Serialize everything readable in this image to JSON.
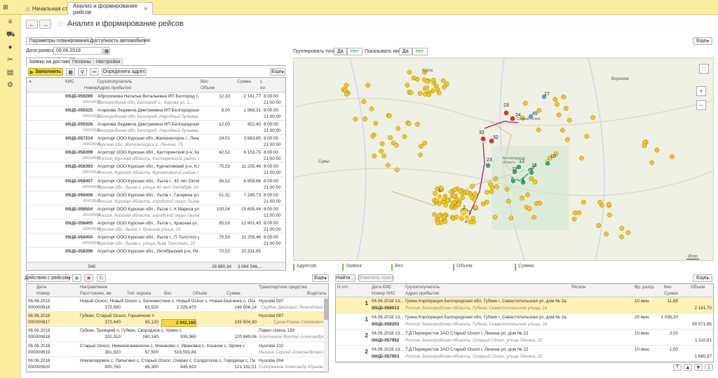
{
  "tabs": {
    "home": "Начальная страница",
    "active": "Анализ и формирование рейсов"
  },
  "page": {
    "title": "Анализ и формирование рейсов"
  },
  "toolbar": {
    "params": "Параметры планирования",
    "availability": "Доступность автомобилей",
    "more": "Еще"
  },
  "date": {
    "label": "Дата развоза:",
    "value": "06.06.2018"
  },
  "map_controls": {
    "group_label": "Группировать точки",
    "show_names_label": "Показывать имя",
    "yes": "Да",
    "no": "Нет",
    "scale": "20 km"
  },
  "subtabs": [
    "Заявки на доставку",
    "Геозоны",
    "Настройки"
  ],
  "orders_toolbar": {
    "fill": "Заполнить",
    "define_address": "Определить адрес",
    "more": "Еще"
  },
  "orders": {
    "headers": {
      "kis": "КИС",
      "number": "Номер",
      "consignee": "Грузополучатель",
      "address": "Адрес прибытия",
      "weight": "Вес",
      "volume": "Объем",
      "sum": "Сумма",
      "from": "с",
      "to": "по"
    },
    "rows": [
      {
        "kis": "00ЦБ-059289",
        "num": "000018373",
        "name": "Абросимова Наталья Витальевна ИП Белгород г.,Белг...",
        "addr": "Белгородская обл, Белгород г., Кирова ул. 2...",
        "w": "12,33",
        "s": "2 141,77",
        "f": "8:00:00",
        "t": "21:00:00"
      },
      {
        "kis": "00ЦБ-059325",
        "num": "000018394",
        "name": "Агаркова Людмила Дмитриевна ИП Белгородская обл.,...",
        "addr": "Белгородская обл, Белгород, Народный бульвар, ...",
        "w": "8,00",
        "s": "1 966,31",
        "f": "8:00:00",
        "t": "21:00:00"
      },
      {
        "kis": "00ЦБ-059326",
        "num": "000018341",
        "name": "Агаркова Людмила Дмитриевна ИП Белгородская обл.,...",
        "addr": "Белгородская обл, Белгород, Народный бульвар, ...",
        "w": "12,00",
        "s": "452,40",
        "f": "8:00:00",
        "t": "21:00:00"
      },
      {
        "kis": "00ЦБ-057214",
        "num": "000018094",
        "name": "Агроторг ООО Курская обл.,Железногорск г., Ленин...",
        "addr": "Курская обл, Железногорск г, Ленина, 79",
        "w": "24,01",
        "s": "3 663,85",
        "f": "8:00:00",
        "t": "21:00:00"
      },
      {
        "kis": "00ЦБ-058399",
        "num": "000018009",
        "name": "Агроторг ООО Курская обл., Касторенский р-н, Ка...",
        "addr": "Россия, Курская область, Касторенский район, пос...",
        "w": "42,52",
        "s": "6 153,75",
        "f": "8:00:00",
        "t": "21:00:00"
      },
      {
        "kis": "00ЦБ-058393",
        "num": "000018012",
        "name": "Агроторг ООО Курская обл., Курчатовский р-н, К.П...",
        "addr": "Россия, Курская область, Курчатовский район, пос...",
        "w": "75,53",
        "s": "11 255,46",
        "f": "8:00:00",
        "t": "21:00:00"
      },
      {
        "kis": "00ЦБ-058407",
        "num": "000018010",
        "name": "Агроторг ООО Курская обл., Льгов г., 40 лет Октяб...",
        "addr": "Курская обл, Льгов г, улица 40 лет Октября, 10",
        "w": "56,52",
        "s": "8 659,66",
        "f": "8:00:00",
        "t": "21:00:00"
      },
      {
        "kis": "00ЦБ-058408",
        "num": "000018013",
        "name": "Агроторг ООО Курская обл., Льгов г., Гагарина ул, ...",
        "addr": "Россия, Курская область, городской округ Льгов, ...",
        "w": "51,31",
        "s": "7 249,73",
        "f": "8:00:00",
        "t": "21:00:00"
      },
      {
        "kis": "00ЦБ-058504",
        "num": "000018006",
        "name": "Агроторг ООО Курская обл., Льгов г., К Маркса ул, ...",
        "addr": "Россия, Курская область, городской округ Льгов, ...",
        "w": "100,04",
        "s": "15 655,44",
        "f": "8:00:00",
        "t": "21:00:00"
      },
      {
        "kis": "00ЦБ-058405",
        "num": "000018014",
        "name": "Агроторг ООО Курская обл., Льгов г., Красная ул, ...",
        "addr": "Курская обл, Льгов г, Красная улица, 15",
        "w": "85,03",
        "s": "12 901,45",
        "f": "8:00:00",
        "t": "21:00:00"
      },
      {
        "kis": "00ЦБ-058404",
        "num": "000018011",
        "name": "Агроторг ООО Курская обл., Льгов г., П.Толстого у...",
        "addr": "Курская обл, Льгов г, улица Льва Толстого, 20",
        "w": "75,53",
        "s": "11 255,46",
        "f": "8:00:00",
        "t": "21:00:00"
      },
      {
        "kis": "00ЦБ-058396",
        "num": "",
        "name": "Агроторг ООО Курская обл., Октябрьский р-н, Ря...",
        "addr": "",
        "w": "70,52",
        "s": "10 331,85",
        "f": "",
        "t": ""
      }
    ],
    "footer": {
      "count": "548",
      "weight": "28 880,34",
      "sum": "3 064 546,..."
    }
  },
  "map": {
    "city_labels": [
      "Курск",
      "Воронеж",
      "Сумы",
      "Белгородская область",
      "Старый Оскол"
    ],
    "clusters": [
      "33",
      "32",
      "23",
      "24",
      "45",
      "17",
      "23",
      "13",
      "12",
      "10",
      "19",
      "9",
      "7",
      "8",
      "1",
      "2",
      "1"
    ]
  },
  "summary": {
    "addresses": "Адресов:",
    "orders": "Заявок:",
    "weight": "Вес:",
    "volume": "Объем:",
    "sum": "Сумма:"
  },
  "trips_toolbar": {
    "actions": "Действия с рейсом",
    "more": "Еще"
  },
  "trips": {
    "headers": {
      "date": "Дата",
      "number": "Номер",
      "direction": "Направление",
      "distance": "Расстояние, км",
      "top": "Топ. оценка",
      "weight": "Вес",
      "volume": "Объем",
      "sum": "Сумма",
      "vehicle": "Транспортное средство",
      "driver": "Водитель"
    },
    "rows": [
      {
        "date": "06.06.2018",
        "num": "000000616",
        "dir": "Новый Оскол, Новый Оскол с, Белеместное с, Новый Оскол с, Новая Безгинка с, Оскольское с...",
        "dist": "379,590",
        "top": "63,520",
        "w": "1 326,470",
        "v": "",
        "s": "149 806,14",
        "veh": "Hyundai 097",
        "drv": "Сербин Дмитрий Леонидович"
      },
      {
        "date": "06.06.2018",
        "num": "000000617",
        "dir": "Губкин, Старый Оскол, Горшечное п",
        "dist": "372,440",
        "top": "65,120",
        "w": "2 942,160",
        "v": "",
        "s": "235 604,30",
        "veh": "Hyundai 087",
        "drv": "Суков Роман Сергеевич"
      },
      {
        "date": "06.06.2018",
        "num": "000000618",
        "dir": "Губкин, Троицкий п, Губкин, Скородное с, Чуево с",
        "dist": "332,310",
        "top": "160,140",
        "w": "939,960",
        "v": "",
        "s": "120 849,06",
        "veh": "Павел газель 139",
        "drv": "Бортников Виктор Александрович"
      },
      {
        "date": "06.06.2018",
        "num": "000000619",
        "dir": "Старый Оскол, Нижнеатаманское с, Монаково с, Ивановка с, Казачок с, Орлик с",
        "dist": "381,920",
        "top": "67,500",
        "w": "519,591,84",
        "v": "",
        "s": "",
        "veh": "Hyundai 102",
        "drv": "Мышин Сергей Александрович"
      },
      {
        "date": "06.06.2018",
        "num": "000000620",
        "dir": "Новоклядовое с, Лапыгино с, Старый Оскол, Озерки с, Солдатское с, Городище с, Песчанка с...",
        "dist": "400,760",
        "top": "66,300",
        "w": "845,620",
        "v": "",
        "s": "121 162,51",
        "veh": "Hyundai 094",
        "drv": "Сидоренков Александр Юрьевич"
      }
    ]
  },
  "details_toolbar": {
    "find": "Найти...",
    "cancel": "Отменить поиск",
    "more": "Еще"
  },
  "details": {
    "headers": {
      "np": "N п/п",
      "date": "Дата КИС",
      "number": "Номер КИС",
      "consignee": "Грузополучатель",
      "address": "Адрес прибытия",
      "region": "Регион",
      "time": "Вр. разгр.",
      "weight": "Вес",
      "sum": "Сумма",
      "volume": "Объем"
    },
    "rows": [
      {
        "n": "1",
        "date": "04.06.2018 13:...",
        "num": "00ЦБ-058013",
        "name": "Гринн Корпорация Белгородская обл, Губкин г, Севастопольская ул, дом № 2а",
        "addr": "Россия, Белгородская область, Губкин, Севастопольская улица, 2а",
        "time": "10 мин.",
        "w": "11,89",
        "s": "2 181,70"
      },
      {
        "n": "1",
        "date": "04.06.2018 13:...",
        "num": "00ЦБ-058203",
        "name": "Гринн Корпорация Белгородская обл, Губкин г, Севастопольская ул, дом № 2а",
        "addr": "Россия, Белгородская область, Губкин, Севастопольская улица, 2а",
        "time": "20 мин.",
        "w": "1 036,20",
        "s": "59 571,85"
      },
      {
        "n": "2",
        "date": "04.06.2018 13:...",
        "num": "00ЦБ-057952",
        "name": "Т.Д Перекресток ЗАО Старый Оскол г, Ленина ул, дом № 22",
        "addr": "Россия, Белгородская область, Старый Оскол, улица Ленина, 22",
        "time": "10 мин.",
        "w": "3,00",
        "s": "1 110,91"
      },
      {
        "n": "2",
        "date": "04.06.2018 13:...",
        "num": "00ЦБ-057953",
        "name": "Т.Д Перекресток ЗАО Старый Оскол г, Ленина ул, дом № 22",
        "addr": "Россия, Белгородская область, Старый Оскол, улица Ленина, 22",
        "time": "10 мин.",
        "w": "1,00",
        "s": "1 685,97"
      }
    ]
  }
}
